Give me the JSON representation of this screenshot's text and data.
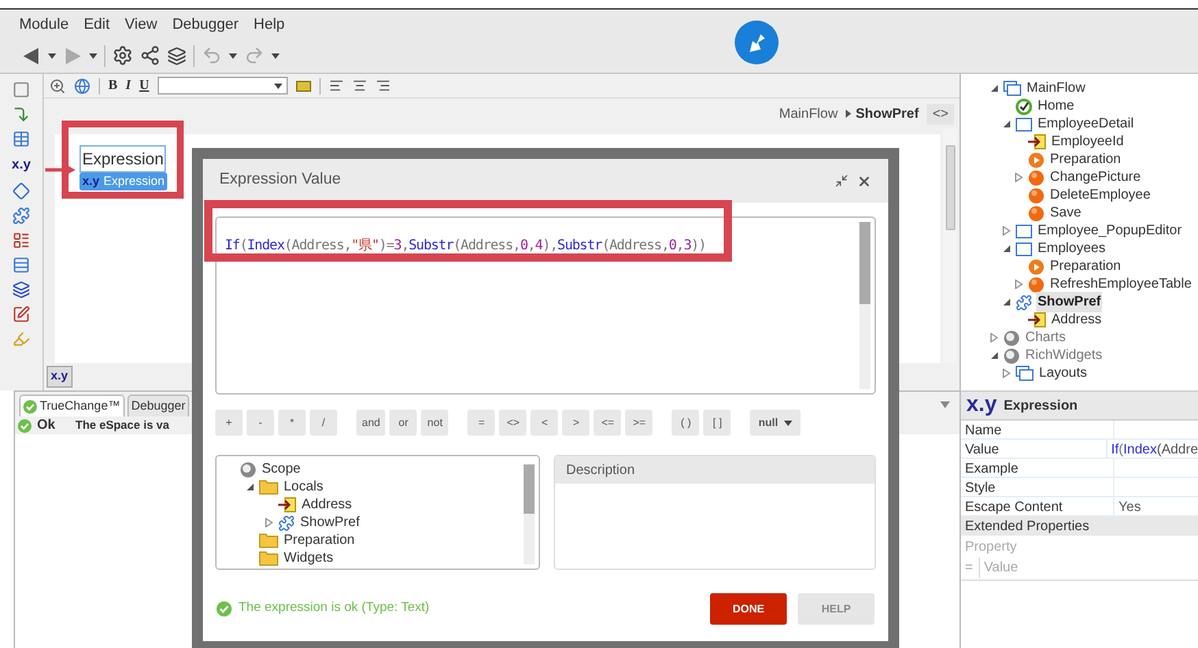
{
  "menu": [
    "Module",
    "Edit",
    "View",
    "Debugger",
    "Help"
  ],
  "designer": {
    "format_letters": [
      "B",
      "I",
      "U"
    ],
    "breadcrumb": {
      "parent": "MainFlow",
      "current": "ShowPref"
    },
    "code_toggle": "<>",
    "widget": {
      "text": "Expression",
      "tag_label": "x.y",
      "tag_text": "Expression"
    },
    "tab_label": "x.y"
  },
  "palette_label": "x.y",
  "bottom_panel": {
    "tabs": [
      {
        "label": "TrueChange™",
        "selected": true
      },
      {
        "label": "Debugger",
        "selected": false
      }
    ],
    "rows": [
      {
        "status": "Ok",
        "message": "The eSpace is va"
      }
    ]
  },
  "dialog": {
    "title": "Expression Value",
    "expression": [
      {
        "text": "If",
        "kind": "function"
      },
      {
        "text": "(",
        "kind": "punct"
      },
      {
        "text": "Index",
        "kind": "function"
      },
      {
        "text": "(Address,",
        "kind": "punct"
      },
      {
        "text": "\"県\"",
        "kind": "string"
      },
      {
        "text": ")=",
        "kind": "punct"
      },
      {
        "text": "3",
        "kind": "number"
      },
      {
        "text": ",",
        "kind": "punct"
      },
      {
        "text": "Substr",
        "kind": "function"
      },
      {
        "text": "(Address,",
        "kind": "punct"
      },
      {
        "text": "0",
        "kind": "number"
      },
      {
        "text": ",",
        "kind": "punct"
      },
      {
        "text": "4",
        "kind": "number"
      },
      {
        "text": "),",
        "kind": "punct"
      },
      {
        "text": "Substr",
        "kind": "function"
      },
      {
        "text": "(Address,",
        "kind": "punct"
      },
      {
        "text": "0",
        "kind": "number"
      },
      {
        "text": ",",
        "kind": "punct"
      },
      {
        "text": "3",
        "kind": "number"
      },
      {
        "text": "))",
        "kind": "punct"
      }
    ],
    "operator_groups": [
      [
        "+",
        "-",
        "*",
        "/"
      ],
      [
        "and",
        "or",
        "not"
      ],
      [
        "=",
        "<>",
        "<",
        ">",
        "<=",
        ">="
      ],
      [
        "( )",
        "[ ]"
      ]
    ],
    "null_dropdown": "null",
    "scope": [
      {
        "label": "Scope",
        "kind": "module",
        "selected": false,
        "children": [
          {
            "label": "Locals",
            "kind": "folder",
            "expanded": true,
            "selected": false,
            "children": [
              {
                "label": "Address",
                "kind": "input",
                "selected": false
              },
              {
                "label": "ShowPref",
                "kind": "webblock",
                "expanded": false,
                "selected": false
              }
            ]
          },
          {
            "label": "Preparation",
            "kind": "folder",
            "selected": false
          },
          {
            "label": "Widgets",
            "kind": "folder",
            "selected": false
          }
        ]
      }
    ],
    "description_title": "Description",
    "status": "The expression is ok (Type: Text)",
    "buttons": [
      {
        "label": "DONE",
        "kind": "primary"
      },
      {
        "label": "HELP",
        "kind": "secondary"
      }
    ]
  },
  "tree": [
    {
      "label": "MainFlow",
      "kind": "flow",
      "expanded": true,
      "selected": false,
      "children": [
        {
          "label": "Home",
          "kind": "home",
          "selected": false
        },
        {
          "label": "EmployeeDetail",
          "kind": "screen",
          "expanded": true,
          "selected": false,
          "children": [
            {
              "label": "EmployeeId",
              "kind": "input",
              "selected": false
            },
            {
              "label": "Preparation",
              "kind": "preparation",
              "selected": false
            },
            {
              "label": "ChangePicture",
              "kind": "action",
              "expanded": false,
              "selected": false
            },
            {
              "label": "DeleteEmployee",
              "kind": "action",
              "selected": false
            },
            {
              "label": "Save",
              "kind": "action",
              "selected": false
            }
          ]
        },
        {
          "label": "Employee_PopupEditor",
          "kind": "screen",
          "expanded": false,
          "selected": false
        },
        {
          "label": "Employees",
          "kind": "screen",
          "expanded": true,
          "selected": false,
          "children": [
            {
              "label": "Preparation",
              "kind": "preparation",
              "selected": false
            },
            {
              "label": "RefreshEmployeeTable",
              "kind": "action",
              "expanded": false,
              "selected": false
            }
          ]
        },
        {
          "label": "ShowPref",
          "kind": "webblock",
          "expanded": true,
          "selected": true,
          "children": [
            {
              "label": "Address",
              "kind": "input",
              "selected": false
            }
          ]
        }
      ]
    },
    {
      "label": "Charts",
      "kind": "module",
      "expanded": false,
      "selected": false
    },
    {
      "label": "RichWidgets",
      "kind": "module",
      "expanded": true,
      "selected": false,
      "children": [
        {
          "label": "Layouts",
          "kind": "flow",
          "expanded": false,
          "selected": false
        }
      ]
    }
  ],
  "properties": {
    "icon_label": "x.y",
    "title": "Expression",
    "rows": [
      {
        "name": "Name",
        "value": []
      },
      {
        "name": "Value",
        "value": [
          {
            "text": "If",
            "kind": "function"
          },
          {
            "text": "(",
            "kind": "punct"
          },
          {
            "text": "Index",
            "kind": "function"
          },
          {
            "text": "(Addre",
            "kind": "plain"
          }
        ]
      },
      {
        "name": "Example",
        "value": []
      },
      {
        "name": "Style",
        "value": []
      },
      {
        "name": "Escape Content",
        "value": [
          {
            "text": "Yes",
            "kind": "plain"
          }
        ]
      }
    ],
    "section": "Extended Properties",
    "property_placeholder": "Property",
    "equals": "=",
    "value_placeholder": "Value"
  }
}
